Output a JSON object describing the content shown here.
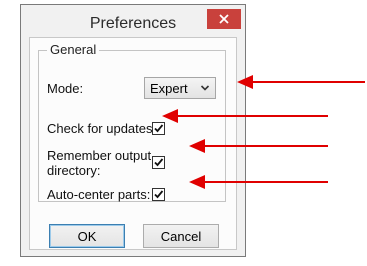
{
  "window": {
    "title": "Preferences",
    "close_icon": "close-icon"
  },
  "group": {
    "title": "General"
  },
  "mode": {
    "label": "Mode:",
    "selected": "Expert"
  },
  "options": {
    "check_updates": {
      "label": "Check for updates:",
      "checked": true
    },
    "remember_dir": {
      "label_line1": "Remember output",
      "label_line2": "directory:",
      "checked": true
    },
    "auto_center": {
      "label": "Auto-center parts:",
      "checked": true
    }
  },
  "buttons": {
    "ok": "OK",
    "cancel": "Cancel"
  },
  "annotations": {
    "arrow_color": "#e00000"
  }
}
